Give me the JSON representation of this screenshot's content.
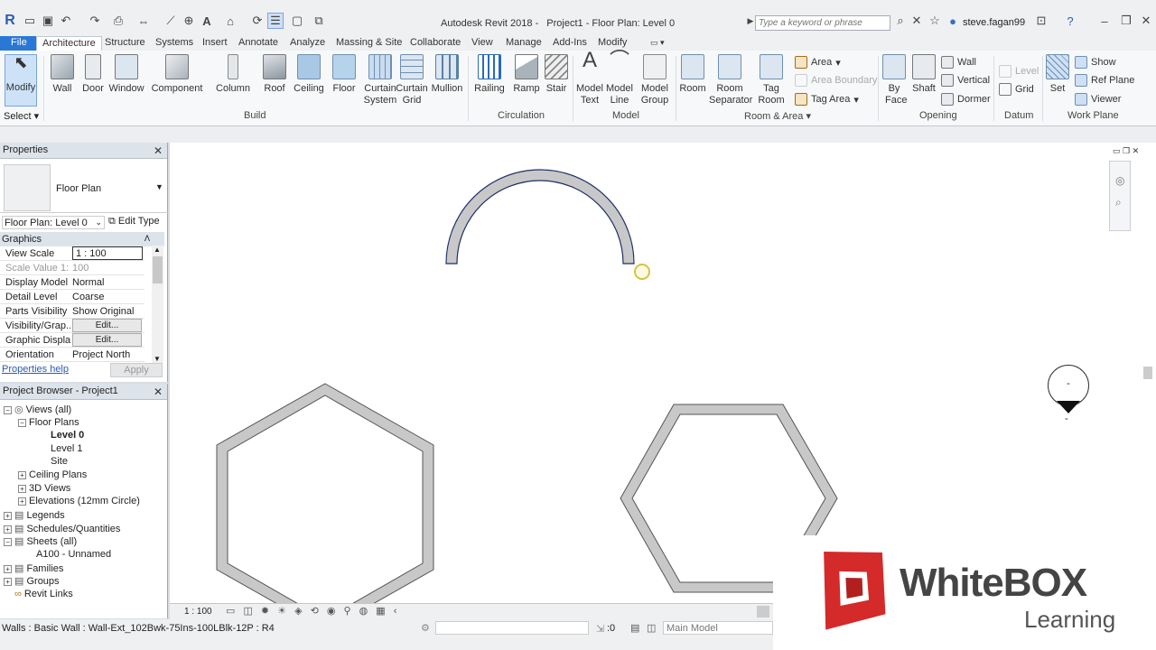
{
  "app": {
    "title": "Autodesk Revit 2018 -",
    "document": "Project1 - Floor Plan: Level 0",
    "search_placeholder": "Type a keyword or phrase",
    "user": "steve.fagan99"
  },
  "tabs": [
    "File",
    "Architecture",
    "Structure",
    "Systems",
    "Insert",
    "Annotate",
    "Analyze",
    "Massing & Site",
    "Collaborate",
    "View",
    "Manage",
    "Add-Ins",
    "Modify"
  ],
  "ribbon": {
    "modify": "Modify",
    "select": "Select",
    "build_tools": [
      "Wall",
      "Door",
      "Window",
      "Component",
      "Column",
      "Roof",
      "Ceiling",
      "Floor",
      "Curtain System",
      "Curtain Grid",
      "Mullion"
    ],
    "circulation_tools": [
      "Railing",
      "Ramp",
      "Stair"
    ],
    "model_tools": [
      "Model Text",
      "Model Line",
      "Model Group"
    ],
    "room_tools": [
      "Room",
      "Room Separator",
      "Tag Room"
    ],
    "area": "Area",
    "area_boundary": "Area  Boundary",
    "tag_area": "Tag  Area",
    "opening_tools": [
      "By Face",
      "Shaft"
    ],
    "opening_small": [
      "Wall",
      "Vertical",
      "Dormer"
    ],
    "datum_small": [
      "Level",
      "Grid"
    ],
    "workplane_set": "Set",
    "workplane_small": [
      "Show",
      "Ref  Plane",
      "Viewer"
    ],
    "groups": {
      "build": "Build",
      "circulation": "Circulation",
      "model": "Model",
      "room": "Room & Area",
      "opening": "Opening",
      "datum": "Datum",
      "workplane": "Work Plane"
    }
  },
  "properties": {
    "title": "Properties",
    "type": "Floor Plan",
    "instance": "Floor Plan: Level 0",
    "edit_type": "Edit Type",
    "section": "Graphics",
    "rows": [
      {
        "k": "View Scale",
        "v": "1 : 100"
      },
      {
        "k": "Scale Value    1:",
        "v": "100"
      },
      {
        "k": "Display Model",
        "v": "Normal"
      },
      {
        "k": "Detail Level",
        "v": "Coarse"
      },
      {
        "k": "Parts Visibility",
        "v": "Show Original"
      },
      {
        "k": "Visibility/Grap...",
        "v": "Edit..."
      },
      {
        "k": "Graphic Displa...",
        "v": "Edit..."
      },
      {
        "k": "Orientation",
        "v": "Project North"
      }
    ],
    "help": "Properties help",
    "apply": "Apply"
  },
  "browser": {
    "title": "Project Browser - Project1",
    "items": [
      "Views (all)",
      "Floor Plans",
      "Level 0",
      "Level 1",
      "Site",
      "Ceiling Plans",
      "3D Views",
      "Elevations (12mm Circle)",
      "Legends",
      "Schedules/Quantities",
      "Sheets (all)",
      "A100 - Unnamed",
      "Families",
      "Groups",
      "Revit Links"
    ]
  },
  "viewbar": {
    "scale": "1 : 100"
  },
  "status": {
    "message": "Walls : Basic Wall : Wall-Ext_102Bwk-75Ins-100LBlk-12P : R4",
    "worksets": ":0",
    "model": "Main Model"
  },
  "elevation_marker": {
    "top": "-",
    "bottom": "-"
  },
  "logo": {
    "brand": "WhiteBOX",
    "sub": "Learning"
  },
  "colors": {
    "file_tab": "#2a78d6",
    "logo_red": "#d42a2a",
    "wall_fill": "#c8c8c8"
  }
}
